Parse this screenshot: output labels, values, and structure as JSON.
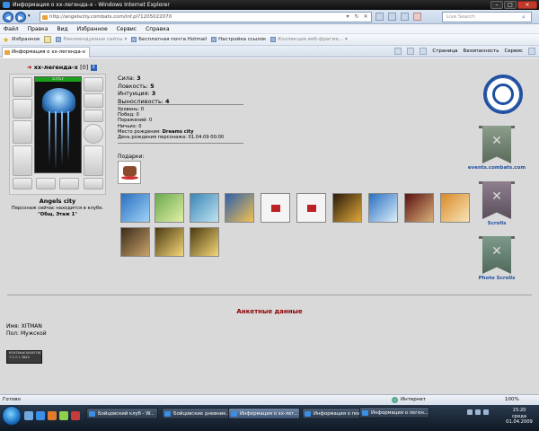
{
  "window": {
    "title": "Информация о хх-легенда-х - Windows Internet Explorer"
  },
  "address": {
    "url": "http://angelscity.combats.com/inf.pl?1205022070"
  },
  "search": {
    "placeholder": "Live Search"
  },
  "menu": [
    "Файл",
    "Правка",
    "Вид",
    "Избранное",
    "Сервис",
    "Справка"
  ],
  "favbar": {
    "favorites_label": "Избранное",
    "items": [
      "Рекомендуемые сайты",
      "Бесплатная почта Hotmail",
      "Настройка ссылок",
      "Коллекция веб-фрагме..."
    ]
  },
  "tab": {
    "label": "Информация о хх-легенда-х"
  },
  "tabtools": {
    "page": "Страница",
    "security": "Безопасность",
    "service": "Сервис"
  },
  "character": {
    "name": "хх-легенда-х",
    "level": "[0]",
    "hp": "57/57",
    "city": "Angels city",
    "location_text": "Персонаж сейчас находится в клубе.",
    "room": "\"Общ. Этаж 1\""
  },
  "stats": {
    "strength_label": "Сила:",
    "strength": "3",
    "agility_label": "Ловкость:",
    "agility": "5",
    "intuition_label": "Интуиция:",
    "intuition": "3",
    "endurance_label": "Выносливость:",
    "endurance": "4"
  },
  "meta": {
    "level_label": "Уровень:",
    "level": "0",
    "wins_label": "Побед:",
    "wins": "0",
    "losses_label": "Поражений:",
    "losses": "0",
    "draws_label": "Ничьих:",
    "draws": "0",
    "birthplace_label": "Место рождения:",
    "birthplace": "Dreams city",
    "birthday_label": "День рождения персонажа:",
    "birthday": "01.04.09 00:00"
  },
  "gifts": {
    "title": "Подарки:"
  },
  "sidebar": {
    "events_label": "events.combats.com",
    "scrolls_label": "Scrolls",
    "photo_label": "Photo Scrolls"
  },
  "anket": {
    "title": "Анкетные данные",
    "name_label": "Имя:",
    "name": "XITMAN",
    "gender_label": "Пол:",
    "gender": "Мужской"
  },
  "counter": {
    "line1": "ROXTAM#1840078CS",
    "line2": "7.5 2.1 3840"
  },
  "statusbar": {
    "left": "Готово",
    "zone": "Интернет",
    "zoom": "100%"
  },
  "taskbar": {
    "tasks": [
      "Бойцовский клуб - W...",
      "Бойцовские дневник...",
      "Информация о хх-лег...",
      "Информация о пон...",
      "Информация о леген..."
    ],
    "time": "15:20",
    "day": "среда",
    "date": "01.04.2009"
  },
  "colors": {
    "page_bg": "#d9d9d9",
    "title_accent": "#8b0000",
    "link_blue": "#1f4fa0"
  }
}
